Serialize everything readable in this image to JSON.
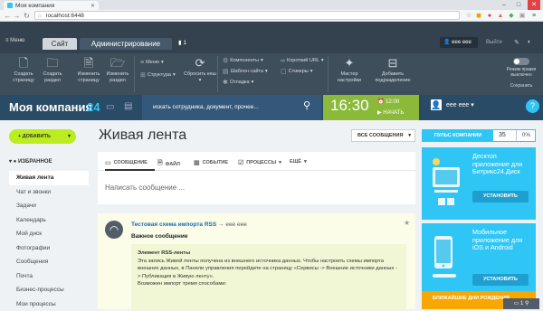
{
  "browser": {
    "tab_title": "Моя компания",
    "url": "localhost:6448",
    "page_icon": "page-icon"
  },
  "admin_panel": {
    "menu_label": "Меню",
    "tab_site": "Сайт",
    "tab_admin": "Администрирование",
    "notifications_count": "1",
    "user_name": "eee eee",
    "logout": "Выйти",
    "tools": [
      {
        "label": "Создать страницу",
        "icon": "page-plus-icon"
      },
      {
        "label": "Создать раздел",
        "icon": "folder-plus-icon"
      },
      {
        "label": "Изменить страницу",
        "icon": "page-edit-icon"
      },
      {
        "label": "Изменить раздел",
        "icon": "folder-edit-icon"
      }
    ],
    "small_tools_1": [
      {
        "label": "Меню",
        "arrow": "▾"
      },
      {
        "label": "Структура",
        "arrow": "▾"
      }
    ],
    "cache_tool": {
      "label": "Сбросить кеш",
      "arrow": "▾"
    },
    "small_tools_2": [
      {
        "label": "Компоненты",
        "arrow": "▾"
      },
      {
        "label": "Шаблон сайта",
        "arrow": "▾"
      },
      {
        "label": "Отладка",
        "arrow": "▾"
      }
    ],
    "small_tools_3": [
      {
        "label": "Короткий URL",
        "arrow": "▾"
      },
      {
        "label": "Стикеры",
        "arrow": "▾"
      }
    ],
    "wizard_tool": "Мастер настройки",
    "add_subdivision_tool": "Добавить подразделение",
    "edit_mode_label": "Режим правки",
    "edit_mode_value": "выключен",
    "save_label": "Сохранить"
  },
  "header": {
    "company": "Моя компания",
    "company_number": "24",
    "search_placeholder": "искать сотрудника, документ, прочее...",
    "time": "16:30",
    "alarm": "12:00",
    "start_label": "НАЧАТЬ",
    "user": "eee eee",
    "help": "?"
  },
  "sidebar": {
    "add_button": "ДОБАВИТЬ",
    "favorites_header": "ИЗБРАННОЕ",
    "items": [
      {
        "label": "Живая лента",
        "active": true
      },
      {
        "label": "Чат и звонки",
        "active": false
      },
      {
        "label": "Задачи",
        "active": false
      },
      {
        "label": "Календарь",
        "active": false
      },
      {
        "label": "Мой диск",
        "active": false
      },
      {
        "label": "Фотографии",
        "active": false
      },
      {
        "label": "Сообщения",
        "active": false
      },
      {
        "label": "Почта",
        "active": false
      },
      {
        "label": "Бизнес-процессы",
        "active": false
      },
      {
        "label": "Мои процессы",
        "active": false
      }
    ]
  },
  "feed": {
    "title": "Живая лента",
    "filter": "ВСЕ СООБЩЕНИЯ",
    "composer_tabs": [
      {
        "label": "СООБЩЕНИЕ",
        "icon": "message-icon"
      },
      {
        "label": "ФАЙЛ",
        "icon": "file-icon"
      },
      {
        "label": "СОБЫТИЕ",
        "icon": "calendar-icon"
      },
      {
        "label": "ПРОЦЕССЫ",
        "icon": "process-icon"
      },
      {
        "label": "ЕЩЁ",
        "icon": ""
      }
    ],
    "composer_placeholder": "Написать сообщение ...",
    "post": {
      "author": "Тестовая схема импорта RSS",
      "recipient_arrow": "→",
      "recipient": "eee eee",
      "title": "Важное сообщение",
      "body_heading": "Элемент RSS-ленты",
      "body_text": "Эта запись Живой ленты получена из внешнего источника данных. Чтобы настроить схемы импорта внешних данных, в Панели управления перейдите на страницу «Сервисы -> Внешние источники данных -> Публикация в Живую ленту».",
      "body_text2": "Возможен импорт тремя способами:"
    }
  },
  "right": {
    "pulse_label": "ПУЛЬС КОМПАНИИ",
    "pulse_value": "35",
    "pulse_percent": "0%",
    "promo1_text": "Десктоп приложение для Битрикс24.Диск",
    "promo1_button": "УСТАНОВИТЬ",
    "promo2_text": "Мобильное приложение для iOS и Android",
    "promo2_button": "УСТАНОВИТЬ",
    "birthdays": "БЛИЖАЙШИЕ ДНИ РОЖДЕНИЯ",
    "chat_count": "1"
  }
}
